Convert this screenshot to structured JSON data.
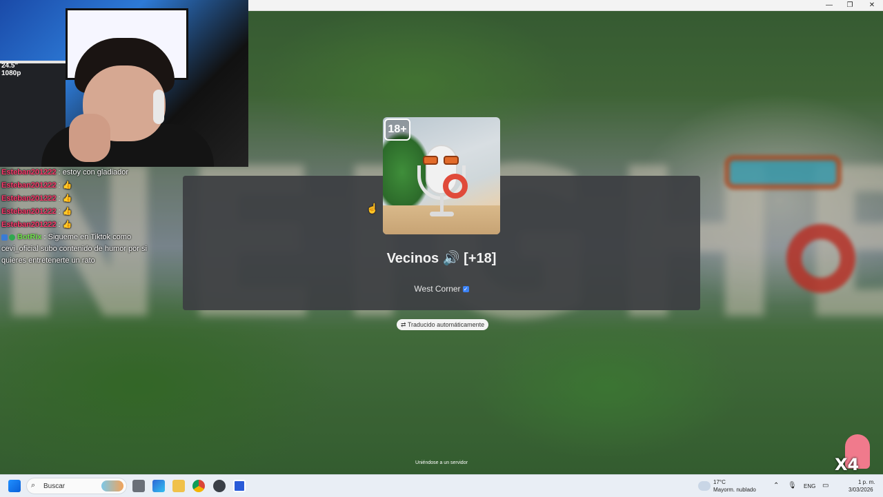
{
  "webcam": {
    "shelf_text": "24.5\"\n1080p"
  },
  "chat": {
    "lines": [
      {
        "user": "Esteban201222",
        "sep": " : ",
        "msg": "estoy con gladiador"
      },
      {
        "user": "Esteban201222",
        "sep": " : ",
        "msg": "👍"
      },
      {
        "user": "Esteban201222",
        "sep": " : ",
        "msg": "👍"
      },
      {
        "user": "Esteban201222",
        "sep": " : ",
        "msg": "👍"
      },
      {
        "user": "Esteban201222",
        "sep": " : ",
        "msg": "👍"
      }
    ],
    "bot": {
      "name": "BotRix",
      "sep": " : ",
      "msg": "Sigueme en Tiktok como cevi_oficial subo contenido de humor por si quieres entretenerte un rato"
    }
  },
  "window": {
    "minimize": "—",
    "restore": "❐",
    "close": "✕"
  },
  "experience": {
    "age_badge": "18+",
    "title": "Vecinos 🔊 [+18]",
    "creator": "West Corner",
    "verified": "✓",
    "translated": "Traducido automáticamente",
    "status": "Uniéndose a un servidor"
  },
  "mascot_text": "X4",
  "taskbar": {
    "search_placeholder": "Buscar",
    "weather_temp": "17°C",
    "weather_desc": "Mayorm. nublado",
    "lang": "ENG",
    "time": "1 p. m.",
    "date": "3/03/2026"
  }
}
